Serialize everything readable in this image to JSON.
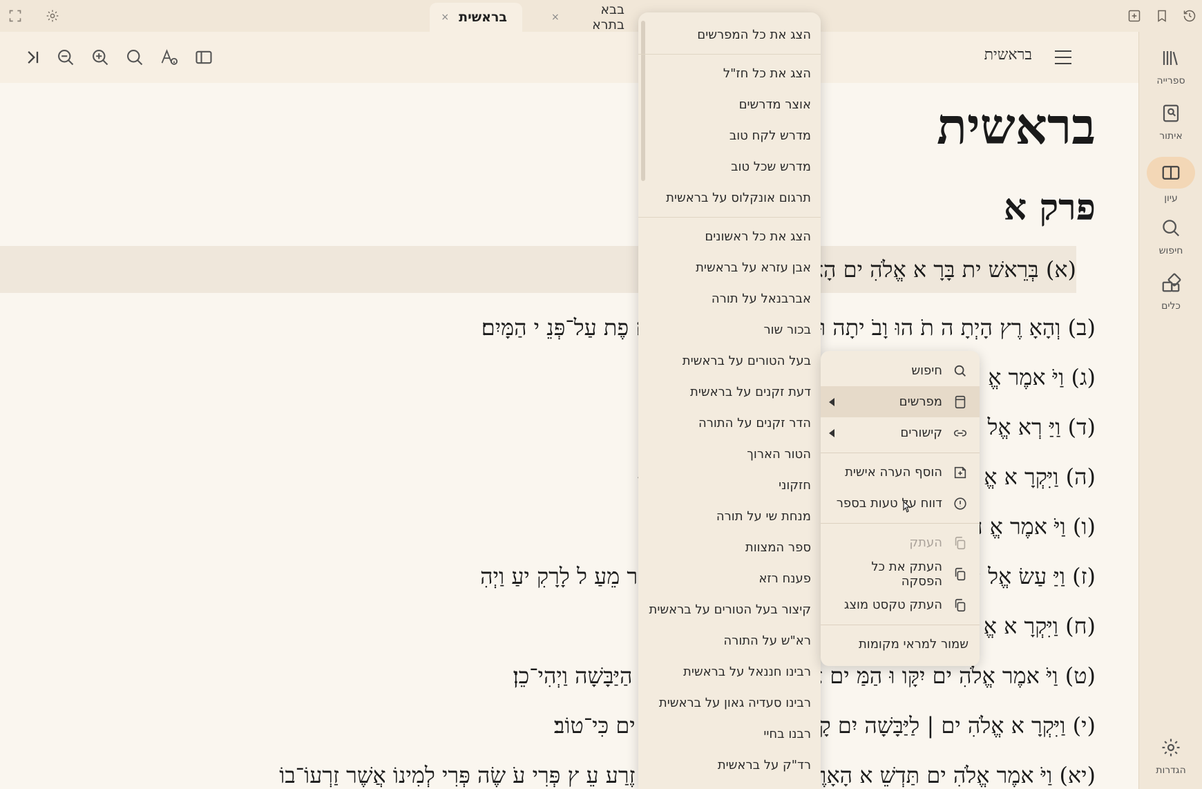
{
  "tabs": [
    {
      "label": "בראשית",
      "active": true
    },
    {
      "label": "בבא בתרא",
      "active": false
    }
  ],
  "tab_close_glyph": "×",
  "titlebar_icons": [
    "fullscreen-icon",
    "gear-icon",
    "new-tab-icon",
    "bookmark-icon",
    "history-icon"
  ],
  "toolbar": {
    "book_name": "בראשית",
    "icons": [
      "sidebar-toggle-icon",
      "text-settings-icon",
      "search-icon",
      "zoom-in-icon",
      "zoom-out-icon",
      "go-to-end-icon"
    ]
  },
  "rail": {
    "items": [
      {
        "label": "ספרייה",
        "icon": "library-icon"
      },
      {
        "label": "איתור",
        "icon": "locate-icon"
      },
      {
        "label": "עיון",
        "icon": "book-open-icon",
        "active": true
      },
      {
        "label": "חיפוש",
        "icon": "search-icon"
      },
      {
        "label": "כלים",
        "icon": "tools-icon"
      }
    ],
    "settings_label": "הגדרות"
  },
  "content": {
    "book_title": "בראשית",
    "chapter_title": "פרק א",
    "verses": [
      "(א) בְּרֵאשׁ  ית בָּרָ  א אֱלֹהִ  ים                                              הָאָרֶץ׃",
      "(ב) וְהָאָ  רֶץ הָיְתָ  ה תֹ  הוּ  וָבֹ                         יתָה וּ  ם וְר וּחַ אֱלֹה  ים מְרַחֶ  פֶת עַל־פְּנֵ  י הַמָּיִם׃",
      "(ג) וַיֹּ  אמֶר אֱ",
      "(ד) וַיַּ  רְא אֱל                                                 לֹה  ים בֵּ  ין הָא  וֹר וּבֵ  ין הַחֹשֶׁךְ׃",
      "(ה) וַיִּקְרָ  א אֱ                                          לְ  יְלָה וַיְהִי־עֶ  רֶב וַיְהִי־בֹ  קֶר יוֹם אֶחָד׃ {פ}",
      "(ו) וַיֹּ  אמֶר אֱ                                          ה  י מַבְדִּ  יל בֵּ  ין מַ  יִם לָמָיִם׃",
      "(ז) וַיַּ  עַשׂ אֱל                           ים אֲשֶׁר  מִתַּ  חַת לָרָקִ  יעַ וּבֵ  ין הַמַּ  יִם אֲשֶׁ  ר מֵעַ  ל לָרָקִ  יעַ וַיְהִ",
      "(ח) וַיִּקְרָ  א אֱ                                          יְהִי־בֹ  קֶר יוֹם שֵׁנִי׃ {פ}",
      "(ט) וַיֹּ  אמֶר אֱלֹהִ  ים יִקָּו  וּ הַמַּ                 ים  אֶל־מָקוֹם אֶחָד וְתֵרָאֶה הַיַּבָּשָׁה וַיְהִי־כֵן׃",
      "(י) וַיִּקְרָ  א אֱלֹהִ  ים | לַיַּבָּשָׁה               יִם קָרָ  א יַמִּ  ים וַיַּ  רְא אֱלֹהִ  ים כִּי־טוֹב׃",
      "(יא) וַיֹּ  אמֶר אֱלֹהִ  ים תַּדְשֵׁ  א הָאָרֶץ דֶּשֶׁא עֵ  שֶׂב מַזְרִ  יעַ זֶרַע עֵ  ץ פְּרִי עֹ  שֶׂה פְּרִי לְמִינוֹ אֲשֶׁר זַרְעוֹ־בוֹ"
    ]
  },
  "commentaries_menu": {
    "items": [
      "הצג את כל המפרשים",
      "הצג את כל חז\"ל",
      "אוצר מדרשים",
      "מדרש לקח טוב",
      "מדרש שכל טוב",
      "תרגום אונקלוס על בראשית",
      "הצג את כל ראשונים",
      "אבן עזרא על בראשית",
      "אברבנאל על תורה",
      "בכור שור",
      "בעל הטורים על בראשית",
      "דעת זקנים על בראשית",
      "הדר זקנים על התורה",
      "הטור הארוך",
      "חזקוני",
      "מנחת שי על תורה",
      "ספר המצוות",
      "פענח רזא",
      "קיצור בעל הטורים על בראשית",
      "רא\"ש על התורה",
      "רבינו חננאל על בראשית",
      "רבינו סעדיה גאון על בראשית",
      "רבנו בחיי",
      "רד\"ק על בראשית"
    ]
  },
  "context_menu": {
    "items": [
      {
        "label": "חיפוש",
        "icon": "search-icon"
      },
      {
        "label": "מפרשים",
        "icon": "book-icon",
        "submenu": true,
        "hover": true
      },
      {
        "label": "קישורים",
        "icon": "link-icon",
        "submenu": true
      },
      {
        "label": "הוסף הערה אישית",
        "icon": "add-note-icon"
      },
      {
        "label": "דווח על טעות בספר",
        "icon": "alert-circle-icon"
      },
      {
        "label": "העתק",
        "icon": "copy-icon",
        "disabled": true
      },
      {
        "label": "העתק את כל הפסקה",
        "icon": "copy-icon"
      },
      {
        "label": "העתק טקסט מוצג",
        "icon": "copy-icon"
      },
      {
        "label": "שמור למראי מקומות",
        "icon": ""
      }
    ]
  }
}
